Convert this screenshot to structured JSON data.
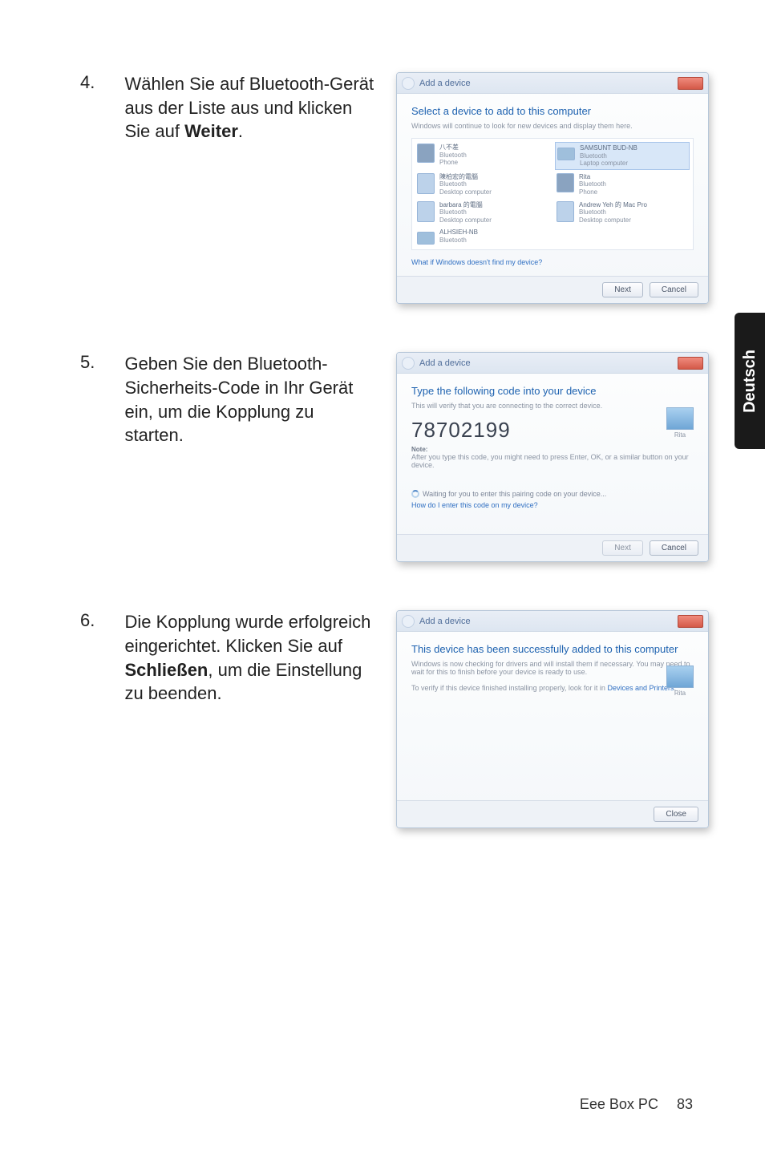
{
  "side_tab": "Deutsch",
  "footer": {
    "product": "Eee Box PC",
    "page": "83"
  },
  "steps": [
    {
      "num": "4.",
      "text_pre": "Wählen Sie auf Bluetooth-Gerät aus der Liste aus und klicken Sie auf ",
      "text_bold": "Weiter",
      "text_post": "."
    },
    {
      "num": "5.",
      "text_pre": "Geben Sie den Bluetooth-Sicherheits-Code in Ihr Gerät ein, um die Kopplung zu starten.",
      "text_bold": "",
      "text_post": ""
    },
    {
      "num": "6.",
      "text_pre": "Die Kopplung wurde erfolgreich eingerichtet. Klicken Sie auf ",
      "text_bold": "Schließen",
      "text_post": ", um die Einstellung zu beenden."
    }
  ],
  "dlg_common": {
    "breadcrumb": "Add a device"
  },
  "dlg1": {
    "title": "Select a device to add to this computer",
    "subtitle": "Windows will continue to look for new devices and display them here.",
    "devices": [
      {
        "name": "八不差",
        "type": "Bluetooth",
        "kind": "Phone"
      },
      {
        "name": "SAMSUNT BUD-NB",
        "type": "Bluetooth",
        "kind": "Laptop computer",
        "selected": true
      },
      {
        "name": "陳柏宏的電腦",
        "type": "Bluetooth",
        "kind": "Desktop computer"
      },
      {
        "name": "Rita",
        "type": "Bluetooth",
        "kind": "Phone"
      },
      {
        "name": "barbara 的電腦",
        "type": "Bluetooth",
        "kind": "Desktop computer"
      },
      {
        "name": "Andrew Yeh 的 Mac Pro",
        "type": "Bluetooth",
        "kind": "Desktop computer"
      },
      {
        "name": "ALHSIEH-NB",
        "type": "Bluetooth",
        "kind": ""
      }
    ],
    "link": "What if Windows doesn't find my device?",
    "btn_next": "Next",
    "btn_cancel": "Cancel"
  },
  "dlg2": {
    "title": "Type the following code into your device",
    "subtitle": "This will verify that you are connecting to the correct device.",
    "code": "78702199",
    "note_label": "Note:",
    "note_text": "After you type this code, you might need to press Enter, OK, or a similar button on your device.",
    "device_label": "Rita",
    "waiting": "Waiting for you to enter this pairing code on your device...",
    "link": "How do I enter this code on my device?",
    "btn_next": "Next",
    "btn_cancel": "Cancel"
  },
  "dlg3": {
    "title": "This device has been successfully added to this computer",
    "body1": "Windows is now checking for drivers and will install them if necessary. You may need to wait for this to finish before your device is ready to use.",
    "body2_pre": "To verify if this device finished installing properly, look for it in ",
    "body2_link": "Devices and Printers",
    "device_label": "Rita",
    "btn_close": "Close"
  }
}
